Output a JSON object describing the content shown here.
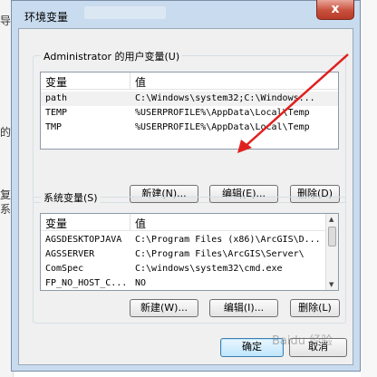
{
  "background": {
    "left_fragments": [
      "导",
      "的",
      "复",
      "系"
    ]
  },
  "dialog": {
    "title": "环境变量",
    "close_symbol": "x",
    "user_vars": {
      "group_label": "Administrator 的用户变量(U)",
      "headers": [
        "变量",
        "值"
      ],
      "rows": [
        {
          "name": "path",
          "value": "C:\\Windows\\system32;C:\\Windows..."
        },
        {
          "name": "TEMP",
          "value": "%USERPROFILE%\\AppData\\Local\\Temp"
        },
        {
          "name": "TMP",
          "value": "%USERPROFILE%\\AppData\\Local\\Temp"
        }
      ],
      "buttons": {
        "new": "新建(N)...",
        "edit": "编辑(E)...",
        "delete": "删除(D)"
      }
    },
    "system_vars": {
      "group_label": "系统变量(S)",
      "headers": [
        "变量",
        "值"
      ],
      "rows": [
        {
          "name": "AGSDESKTOPJAVA",
          "value": "C:\\Program Files (x86)\\ArcGIS\\D..."
        },
        {
          "name": "AGSSERVER",
          "value": "C:\\Program Files\\ArcGIS\\Server\\"
        },
        {
          "name": "ComSpec",
          "value": "C:\\windows\\system32\\cmd.exe"
        },
        {
          "name": "FP_NO_HOST_C...",
          "value": "NO"
        }
      ],
      "buttons": {
        "new": "新建(W)...",
        "edit": "编辑(I)...",
        "delete": "删除(L)"
      }
    },
    "footer": {
      "ok": "确定",
      "cancel": "取消"
    }
  },
  "annotation": {
    "arrow_color": "#e02020"
  },
  "watermark": "Baidu 经验"
}
